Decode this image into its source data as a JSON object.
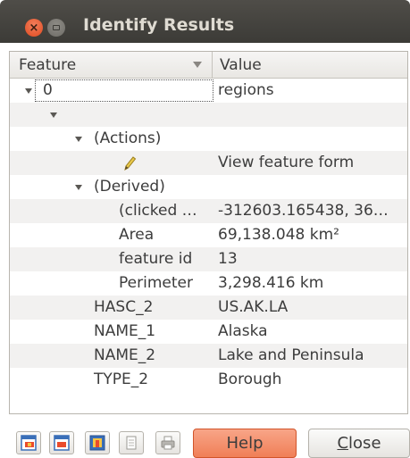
{
  "window": {
    "title": "Identify Results",
    "close_glyph": "×"
  },
  "table": {
    "headers": {
      "feature": "Feature",
      "value": "Value"
    },
    "rows": [
      {
        "feature": "0",
        "value": "regions"
      },
      {
        "feature": "",
        "value": ""
      },
      {
        "feature": "(Actions)",
        "value": ""
      },
      {
        "feature": "",
        "value": "View feature form",
        "icon": "pencil-icon"
      },
      {
        "feature": "(Derived)",
        "value": ""
      },
      {
        "feature": "(clicked …",
        "value": "-312603.165438, 36…"
      },
      {
        "feature": "Area",
        "value": "69,138.048 km²"
      },
      {
        "feature": "feature id",
        "value": "13"
      },
      {
        "feature": "Perimeter",
        "value": "3,298.416 km"
      },
      {
        "feature": "HASC_2",
        "value": "US.AK.LA"
      },
      {
        "feature": "NAME_1",
        "value": "Alaska"
      },
      {
        "feature": "NAME_2",
        "value": "Lake and Peninsula"
      },
      {
        "feature": "TYPE_2",
        "value": "Borough"
      }
    ]
  },
  "toolbar": {
    "icons": [
      "expand-tree-icon",
      "collapse-tree-icon",
      "expand-new-icon",
      "copy-icon",
      "print-icon"
    ],
    "help_label": "Help",
    "close_label_underlined": "C",
    "close_label_rest": "lose"
  },
  "colors": {
    "titlebar": "#3c3b37",
    "help_button": "#f07f57",
    "close_window": "#df4a20",
    "alt_row": "#f2f1f0"
  }
}
